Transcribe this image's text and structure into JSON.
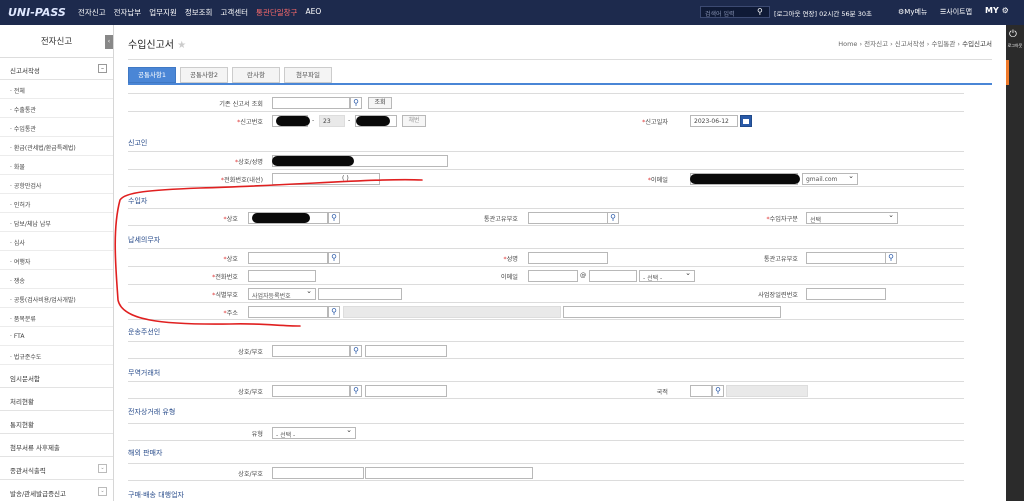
{
  "topbar": {
    "logo": "UNI-PASS",
    "menu": [
      "전자신고",
      "전자납부",
      "업무지원",
      "정보조회",
      "고객센터"
    ],
    "menu_red": "통관단일창구",
    "menu_last": "AEO",
    "search_placeholder": "검색어 입력",
    "login_info": "[로그아웃 연장] 02시간 56분 30초",
    "my_menu": "My메뉴",
    "sitemap": "사이트맵",
    "my": "MY"
  },
  "sidebar": {
    "title": "전자신고",
    "group": "신고서작성",
    "items": [
      "· 전체",
      "· 수출통관",
      "· 수입통관",
      "· 환급(관세법/환급특례법)",
      "· 화물",
      "· 공항만검사",
      "· 인허가",
      "· 담보/체납 납부",
      "· 심사",
      "· 여행자",
      "· 쟁송",
      "· 공통(검사비용/업사개발)",
      "· 품목분류",
      "· FTA",
      "· 법규준수도"
    ],
    "sections": [
      "임시문서함",
      "처리현황",
      "통지현황",
      "첨부서류 사후제출",
      "종관서식출력",
      "발송/관세발급증신고"
    ]
  },
  "page": {
    "title": "수입신고서",
    "star": "★",
    "breadcrumb": [
      "Home",
      "전자신고",
      "신고서작성",
      "수입통관"
    ],
    "breadcrumb_last": "수입신고서"
  },
  "tabs": [
    "공통사항1",
    "공통사항2",
    "란사항",
    "첨부파일"
  ],
  "form": {
    "lookup_label": "기존 신고서 조회",
    "lookup_btn": "조회",
    "decl_no_label": "신고번호",
    "decl_no_mid": "23",
    "decl_btn": "채번",
    "decl_date_label": "신고일자",
    "decl_date": "2023-06-12",
    "sec_declarant": "신고인",
    "name_label": "상호/성명",
    "phone_label": "전화번호(내선)",
    "phone_value": "(            )",
    "email_label": "이메일",
    "email_domain": "gmail.com",
    "sec_importer": "수입자",
    "importer_name_label": "상호",
    "customs_code_label": "통관고유부호",
    "importer_type_label": "수입자구분",
    "select_default": "선택",
    "sec_taxpayer": "납세의무자",
    "tax_name_label": "상호",
    "tax_person_label": "성명",
    "tax_code_label": "통관고유부호",
    "tax_phone_label": "전화번호",
    "tax_email_label": "이메일",
    "at": "@",
    "email_select": "- 선택 -",
    "id_label": "식별부호",
    "id_select": "사업자등록번호",
    "biz_label": "사업장일련번호",
    "addr_label": "주소",
    "sec_forwarder": "운송주선인",
    "fwd_label": "상호/부호",
    "sec_trader": "무역거래처",
    "trader_label": "상호/부호",
    "country_label": "국적",
    "sec_ecom": "전자상거래 유형",
    "ecom_label": "유형",
    "ecom_select": "- 선택 -",
    "sec_seller": "해외 판매자",
    "seller_label": "상호/부호",
    "sec_purchase": "구매·배송 대행업자"
  },
  "right_dock": {
    "logout": "로그아웃"
  },
  "colors": {
    "topbar": "#1d2a4d",
    "tab_active": "#4a86d6",
    "annotation": "#e02020"
  }
}
